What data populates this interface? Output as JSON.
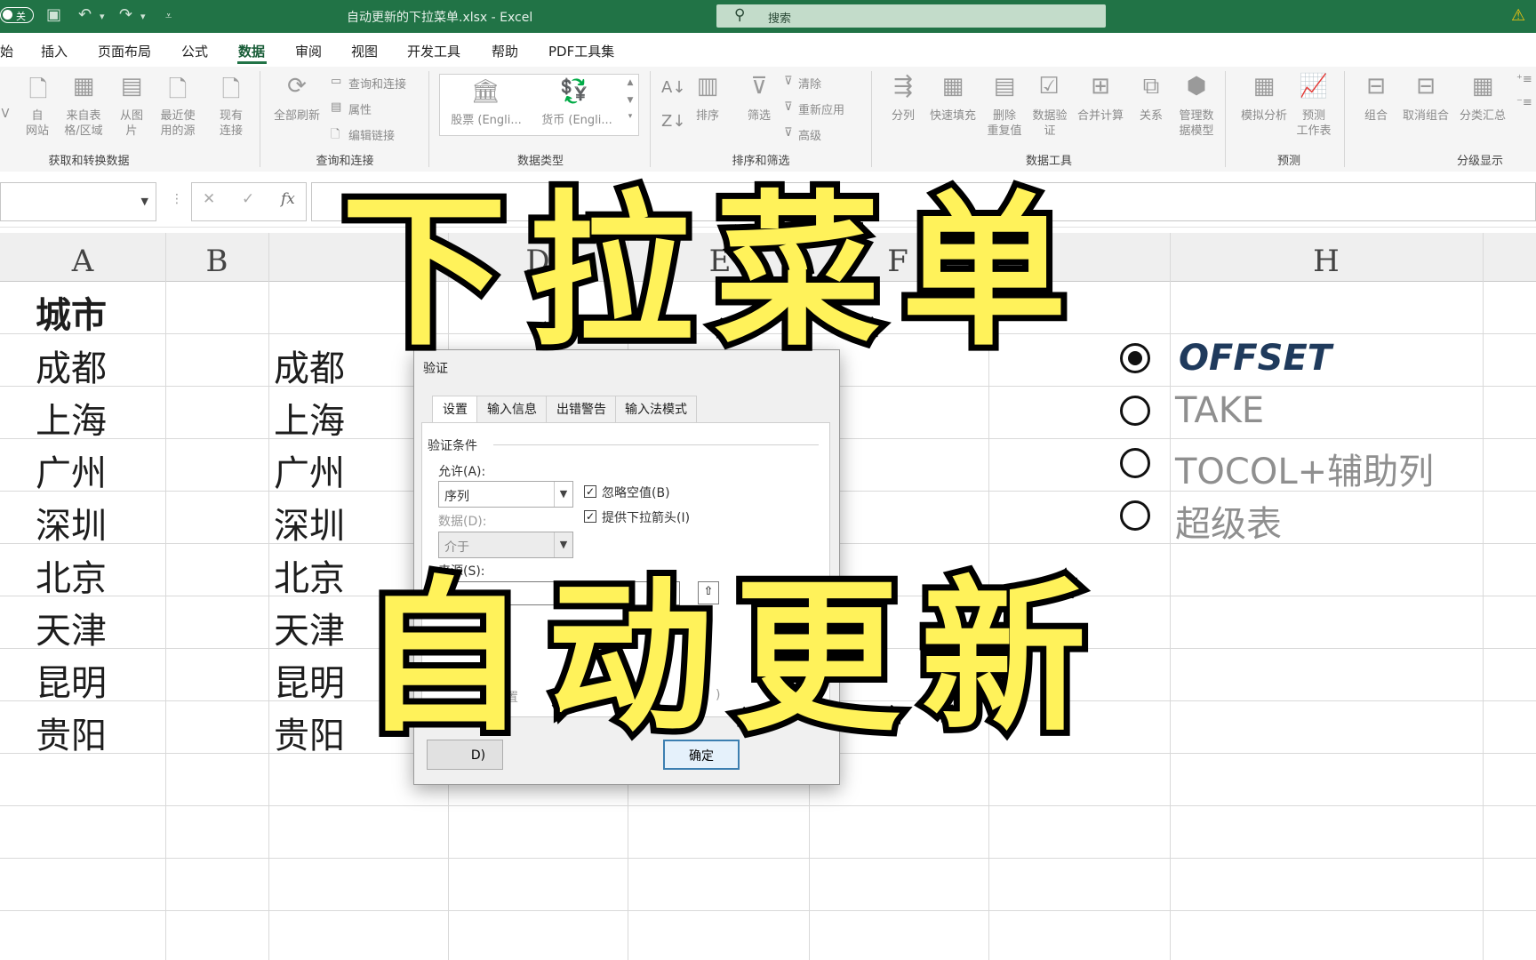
{
  "titlebar": {
    "autosave_label": "关",
    "doc_title": "自动更新的下拉菜单.xlsx  -  Excel",
    "search_placeholder": "搜索"
  },
  "tabs": [
    "始",
    "插入",
    "页面布局",
    "公式",
    "数据",
    "审阅",
    "视图",
    "开发工具",
    "帮助",
    "PDF工具集"
  ],
  "active_tab": "数据",
  "ribbon": {
    "get_data": {
      "buttons": [
        "自\n网站",
        "来自表\n格/区域",
        "从图\n片",
        "最近使\n用的源",
        "现有\n连接"
      ],
      "partial": "V",
      "group_label": "获取和转换数据"
    },
    "queries": {
      "refresh_all": "全部刷新",
      "items": [
        "查询和连接",
        "属性",
        "编辑链接"
      ],
      "group_label": "查询和连接"
    },
    "data_types": {
      "items": [
        "股票 (Engli...",
        "货币 (Engli..."
      ],
      "group_label": "数据类型"
    },
    "sort_filter": {
      "sort": "排序",
      "filter": "筛选",
      "items": [
        "清除",
        "重新应用",
        "高级"
      ],
      "group_label": "排序和筛选"
    },
    "data_tools": {
      "buttons": [
        "分列",
        "快速填充",
        "删除\n重复值",
        "数据验\n证",
        "合并计算",
        "关系",
        "管理数\n据模型"
      ],
      "group_label": "数据工具"
    },
    "forecast": {
      "buttons": [
        "模拟分析",
        "预测\n工作表"
      ],
      "group_label": "预测"
    },
    "outline": {
      "buttons": [
        "组合",
        "取消组合",
        "分类汇总"
      ],
      "group_label": "分级显示"
    }
  },
  "formula_bar": {
    "cancel": "✕",
    "enter": "✓",
    "fx": "fx"
  },
  "columns": [
    "A",
    "B",
    "D",
    "E",
    "F",
    "H"
  ],
  "col_a": {
    "header": "城市",
    "values": [
      "成都",
      "上海",
      "广州",
      "深圳",
      "北京",
      "天津",
      "昆明",
      "贵阳"
    ]
  },
  "col_c_values": [
    "成都",
    "上海",
    "广州",
    "深圳",
    "北京",
    "天津",
    "昆明",
    "贵阳"
  ],
  "options": [
    {
      "label": "OFFSET",
      "selected": true
    },
    {
      "label": "TAKE",
      "selected": false
    },
    {
      "label": "TOCOL+辅助列",
      "selected": false
    },
    {
      "label": "超级表",
      "selected": false
    }
  ],
  "dialog": {
    "title": "验证",
    "tabs": [
      "设置",
      "输入信息",
      "出错警告",
      "输入法模式"
    ],
    "section": "验证条件",
    "allow_label": "允许(A):",
    "allow_value": "序列",
    "data_label": "数据(D):",
    "data_value": "介于",
    "ignore_blank": "忽略空值(B)",
    "dropdown_arrow": "提供下拉箭头(I)",
    "source_label": "来源(S):",
    "apply_label": "样设置",
    "apply_suffix": ")",
    "clear_btn": "D)",
    "ok_btn": "确定"
  },
  "overlay": {
    "line1": "下拉菜单",
    "line2": "自动更新"
  },
  "colors": {
    "excel_green": "#217346",
    "overlay_yellow": "#fff25a"
  }
}
